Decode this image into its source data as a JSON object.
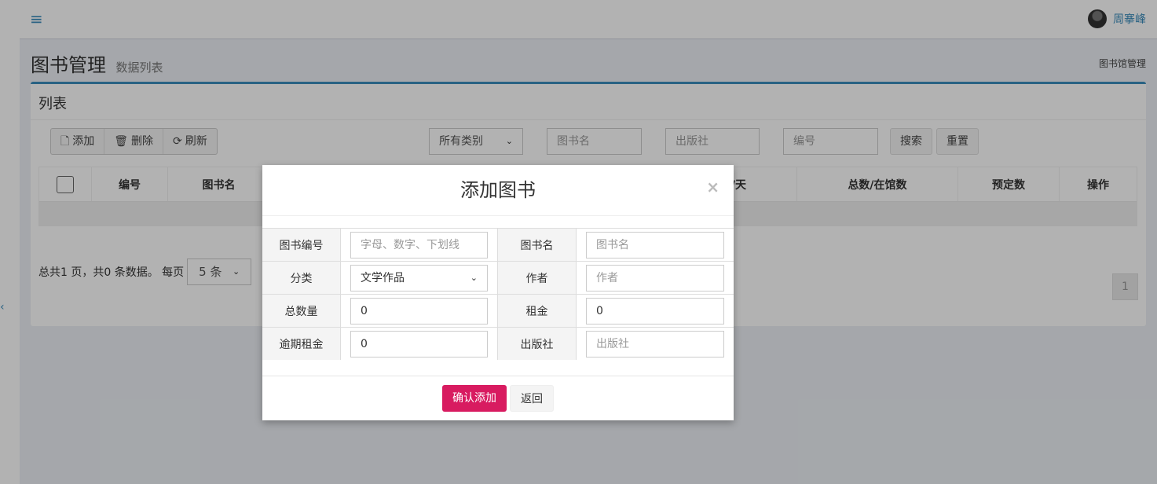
{
  "topbar": {
    "menu_icon": "≡",
    "username": "周搴峰"
  },
  "header": {
    "title": "图书管理",
    "subtitle": "数据列表",
    "breadcrumb": "图书馆管理"
  },
  "box": {
    "title": "列表"
  },
  "toolbar": {
    "add_label": "添加",
    "delete_label": "删除",
    "refresh_label": "刷新"
  },
  "filters": {
    "category_selected": "所有类别",
    "book_name_placeholder": "图书名",
    "publisher_placeholder": "出版社",
    "number_placeholder": "编号",
    "search_label": "搜索",
    "reset_label": "重置"
  },
  "table": {
    "columns": [
      "编号",
      "图书名",
      "/天",
      "总数/在馆数",
      "预定数",
      "操作"
    ]
  },
  "pager": {
    "info": "总共1 页，共0 条数据。 每页",
    "per_page": "5 条",
    "current_page": "1"
  },
  "modal": {
    "title": "添加图书",
    "close_icon": "×",
    "fields": {
      "book_number_label": "图书编号",
      "book_number_placeholder": "字母、数字、下划线",
      "book_name_label": "图书名",
      "book_name_placeholder": "图书名",
      "category_label": "分类",
      "category_selected": "文学作品",
      "author_label": "作者",
      "author_placeholder": "作者",
      "total_label": "总数量",
      "total_value": "0",
      "rent_label": "租金",
      "rent_value": "0",
      "overdue_label": "逾期租金",
      "overdue_value": "0",
      "publisher_label": "出版社",
      "publisher_placeholder": "出版社"
    },
    "confirm_label": "确认添加",
    "back_label": "返回"
  },
  "colors": {
    "accent": "#3c8dbc",
    "confirm": "#d81b60"
  }
}
